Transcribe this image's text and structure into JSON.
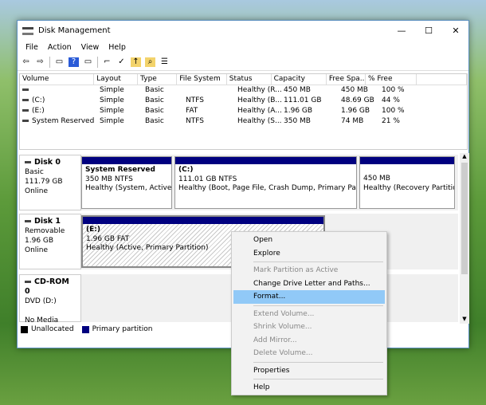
{
  "window": {
    "title": "Disk Management",
    "controls": [
      "—",
      "☐",
      "✕"
    ]
  },
  "menubar": [
    "File",
    "Action",
    "View",
    "Help"
  ],
  "toolbar": [
    {
      "icon": "back-icon",
      "g": "⇦"
    },
    {
      "icon": "forward-icon",
      "g": "⇨"
    },
    {
      "icon": "console-tree-icon",
      "g": "▭"
    },
    {
      "icon": "help-icon",
      "g": "?"
    },
    {
      "icon": "action-pane-icon",
      "g": "▭"
    },
    {
      "icon": "connect-icon",
      "g": "⌐"
    },
    {
      "icon": "checklist-icon",
      "g": "✓"
    },
    {
      "icon": "up-folder-icon",
      "g": "↑"
    },
    {
      "icon": "search-folder-icon",
      "g": "⌕"
    },
    {
      "icon": "properties-icon",
      "g": "☰"
    }
  ],
  "volumes": {
    "headers": [
      "Volume",
      "Layout",
      "Type",
      "File System",
      "Status",
      "Capacity",
      "Free Spa...",
      "% Free"
    ],
    "rows": [
      [
        "",
        "Simple",
        "Basic",
        "",
        "Healthy (R...",
        "450 MB",
        "450 MB",
        "100 %"
      ],
      [
        "(C:)",
        "Simple",
        "Basic",
        "NTFS",
        "Healthy (B...",
        "111.01 GB",
        "48.69 GB",
        "44 %"
      ],
      [
        "(E:)",
        "Simple",
        "Basic",
        "FAT",
        "Healthy (A...",
        "1.96 GB",
        "1.96 GB",
        "100 %"
      ],
      [
        "System Reserved",
        "Simple",
        "Basic",
        "NTFS",
        "Healthy (S...",
        "350 MB",
        "74 MB",
        "21 %"
      ]
    ]
  },
  "disks": [
    {
      "name": "Disk 0",
      "lines": [
        "Basic",
        "111.79 GB",
        "Online"
      ],
      "parts": [
        {
          "name": "System Reserved",
          "size": "350 MB NTFS",
          "status": "Healthy (System, Active, P"
        },
        {
          "name": "(C:)",
          "size": "111.01 GB NTFS",
          "status": "Healthy (Boot, Page File, Crash Dump, Primary Partition"
        },
        {
          "name": "",
          "size": "450 MB",
          "status": "Healthy (Recovery Partition)"
        }
      ]
    },
    {
      "name": "Disk 1",
      "lines": [
        "Removable",
        "1.96 GB",
        "Online"
      ],
      "parts": [
        {
          "name": "(E:)",
          "size": "1.96 GB FAT",
          "status": "Healthy (Active, Primary Partition)"
        }
      ]
    },
    {
      "name": "CD-ROM 0",
      "lines": [
        "DVD (D:)",
        "",
        "No Media"
      ],
      "parts": []
    }
  ],
  "legend": [
    {
      "label": "Unallocated",
      "color": "#000000"
    },
    {
      "label": "Primary partition",
      "color": "#00007f"
    }
  ],
  "context_menu": [
    {
      "label": "Open"
    },
    {
      "label": "Explore"
    },
    {
      "sep": true
    },
    {
      "label": "Mark Partition as Active",
      "disabled": true
    },
    {
      "label": "Change Drive Letter and Paths..."
    },
    {
      "label": "Format...",
      "highlighted": true
    },
    {
      "sep": true
    },
    {
      "label": "Extend Volume...",
      "disabled": true
    },
    {
      "label": "Shrink Volume...",
      "disabled": true
    },
    {
      "label": "Add Mirror...",
      "disabled": true
    },
    {
      "label": "Delete Volume...",
      "disabled": true
    },
    {
      "sep": true
    },
    {
      "label": "Properties"
    },
    {
      "sep": true
    },
    {
      "label": "Help"
    }
  ]
}
